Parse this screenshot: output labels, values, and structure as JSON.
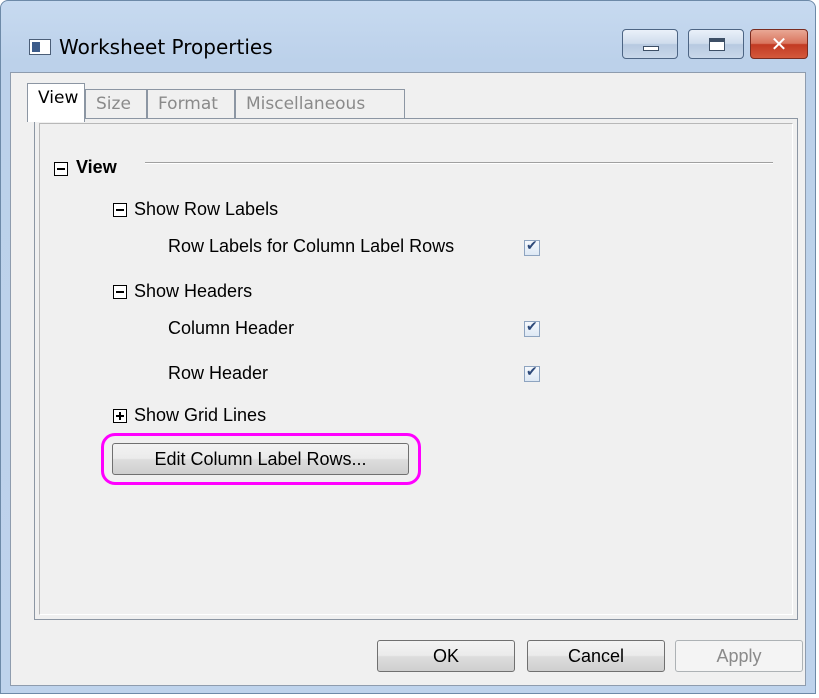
{
  "window": {
    "title": "Worksheet Properties"
  },
  "tabs": [
    {
      "label": "View",
      "active": true
    },
    {
      "label": "Size",
      "active": false
    },
    {
      "label": "Format",
      "active": false
    },
    {
      "label": "Miscellaneous",
      "active": false
    }
  ],
  "tree": {
    "view": {
      "label": "View",
      "expanded": true
    },
    "show_row_labels": {
      "label": "Show Row Labels",
      "expanded": true
    },
    "row_labels_for_column_label_rows": {
      "label": "Row Labels for Column Label Rows",
      "checked": true
    },
    "show_headers": {
      "label": "Show Headers",
      "expanded": true
    },
    "column_header": {
      "label": "Column Header",
      "checked": true
    },
    "row_header": {
      "label": "Row Header",
      "checked": true
    },
    "show_grid_lines": {
      "label": "Show Grid Lines",
      "expanded": false
    }
  },
  "edit_button": {
    "label": "Edit Column Label Rows..."
  },
  "footer": {
    "ok": "OK",
    "cancel": "Cancel",
    "apply": "Apply"
  },
  "colors": {
    "highlight": "#ff00ff",
    "title_bar": "#bcd1ea",
    "close_button": "#c23a22"
  },
  "icons": {
    "window": "worksheet-window-icon",
    "minimize": "minimize-icon",
    "maximize": "maximize-icon",
    "close": "close-icon",
    "collapse": "minus-box-icon",
    "expand": "plus-box-icon",
    "check": "checkmark-icon"
  }
}
